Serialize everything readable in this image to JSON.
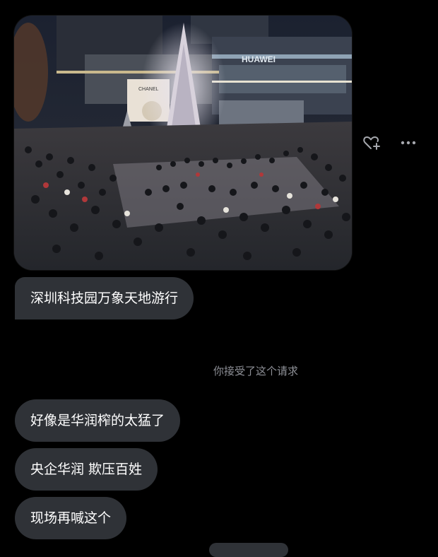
{
  "photo": {
    "store_sign": "HUAWEI",
    "brand_sign": "CHANEL"
  },
  "actions": {
    "heart_add_icon": "heart-plus-icon",
    "more_icon": "more-horizontal-icon"
  },
  "messages": [
    {
      "text": "深圳科技园万象天地游行"
    },
    {
      "text": "好像是华润榨的太猛了"
    },
    {
      "text": "央企华润 欺压百姓"
    },
    {
      "text": "现场再喊这个"
    }
  ],
  "system_note": "你接受了这个请求",
  "colors": {
    "background": "#000000",
    "bubble": "#2f3237",
    "system_text": "#8e9097"
  }
}
